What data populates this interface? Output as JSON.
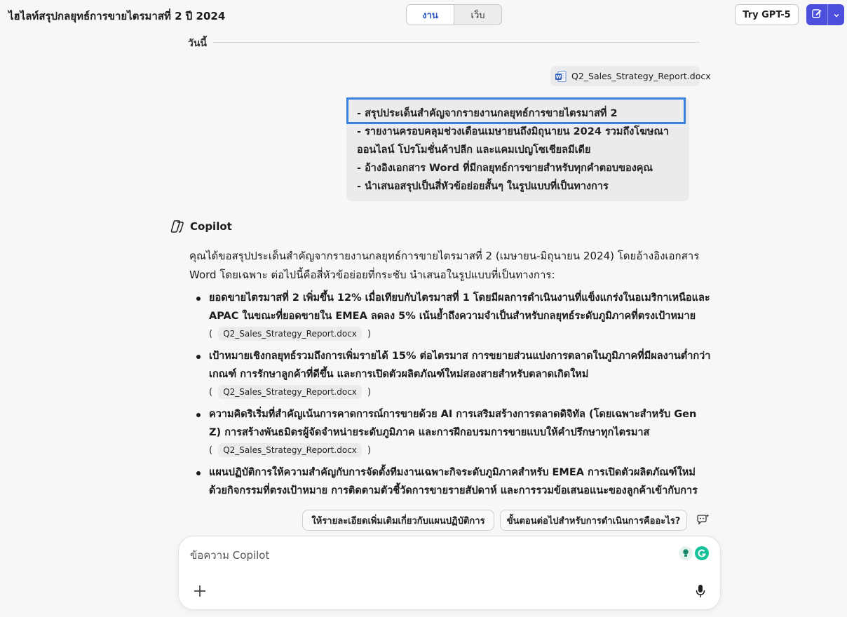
{
  "header": {
    "title": "ไฮไลท์สรุปกลยุทธ์การขายไตรมาสที่ 2 ปี 2024",
    "tabs": [
      {
        "label": "งาน",
        "active": true
      },
      {
        "label": "เว็บ",
        "active": false
      }
    ],
    "try_button": "Try GPT-5",
    "new_chat_icon": "compose-icon",
    "dropdown_icon": "chevron-down-icon",
    "accent_color": "#4b4fdc"
  },
  "conversation": {
    "date_label": "วันนี้",
    "attachment": {
      "name": "Q2_Sales_Strategy_Report.docx",
      "icon": "word-doc-icon"
    },
    "user_message": [
      "- สรุปประเด็นสำคัญจากรายงานกลยุทธ์การขายไตรมาสที่ 2",
      "- รายงานครอบคลุมช่วงเดือนเมษายนถึงมิถุนายน 2024 รวมถึงโฆษณา",
      "ออนไลน์ โปรโมชั่นค้าปลีก และแคมเปญโซเชียลมีเดีย",
      "- อ้างอิงเอกสาร Word ที่มีกลยุทธ์การขายสำหรับทุกคำตอบของคุณ",
      "- นำเสนอสรุปเป็นสี่หัวข้อย่อยสั้นๆ ในรูปแบบที่เป็นทางการ"
    ],
    "assistant": {
      "name": "Copilot",
      "intro": "คุณได้ขอสรุปประเด็นสำคัญจากรายงานกลยุทธ์การขายไตรมาสที่ 2 (เมษายน-มิถุนายน 2024) โดยอ้างอิงเอกสาร Word โดยเฉพาะ ต่อไปนี้คือสี่หัวข้อย่อยที่กระชับ นำเสนอในรูปแบบที่เป็นทางการ:",
      "bullets": [
        {
          "text": "ยอดขายไตรมาสที่ 2 เพิ่มขึ้น 12% เมื่อเทียบกับไตรมาสที่ 1 โดยมีผลการดำเนินงานที่แข็งแกร่งในอเมริกาเหนือและ APAC ในขณะที่ยอดขายใน EMEA ลดลง 5% เน้นย้ำถึงความจำเป็นสำหรับกลยุทธ์ระดับภูมิภาคที่ตรงเป้าหมาย",
          "citation": "Q2_Sales_Strategy_Report.docx"
        },
        {
          "text": "เป้าหมายเชิงกลยุทธ์รวมถึงการเพิ่มรายได้ 15% ต่อไตรมาส การขยายส่วนแบ่งการตลาดในภูมิภาคที่มีผลงานต่ำกว่าเกณฑ์ การรักษาลูกค้าที่ดีขึ้น และการเปิดตัวผลิตภัณฑ์ใหม่สองสายสำหรับตลาดเกิดใหม่",
          "citation": "Q2_Sales_Strategy_Report.docx"
        },
        {
          "text": "ความคิดริเริ่มที่สำคัญเน้นการคาดการณ์การขายด้วย AI การเสริมสร้างการตลาดดิจิทัล (โดยเฉพาะสำหรับ Gen Z) การสร้างพันธมิตรผู้จัดจำหน่ายระดับภูมิภาค และการฝึกอบรมการขายแบบให้คำปรึกษาทุกไตรมาส",
          "citation": "Q2_Sales_Strategy_Report.docx"
        },
        {
          "text": "แผนปฏิบัติการให้ความสำคัญกับการจัดตั้งทีมงานเฉพาะกิจระดับภูมิภาคสำหรับ EMEA การเปิดตัวผลิตภัณฑ์ใหม่ด้วยกิจกรรมที่ตรงเป้าหมาย การติดตามตัวชี้วัดการขายรายสัปดาห์ และการรวมข้อเสนอแนะของลูกค้าเข้ากับการพัฒนาผลิตภัณฑ์",
          "citation": ""
        }
      ]
    }
  },
  "suggestions": [
    "ให้รายละเอียดเพิ่มเติมเกี่ยวกับแผนปฏิบัติการ",
    "ขั้นตอนต่อไปสำหรับการดำเนินการคืออะไร?"
  ],
  "composer": {
    "placeholder": "ข้อความ Copilot",
    "value": "",
    "plus_icon": "plus-icon",
    "mic_icon": "microphone-icon"
  }
}
